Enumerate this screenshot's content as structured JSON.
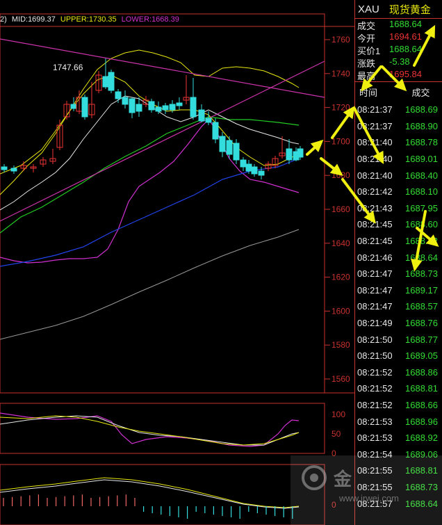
{
  "indicator_line": {
    "prefix": "2)",
    "mid": "MID:1699.37",
    "upper": "UPPER:1730.35",
    "lower": "LOWER:1668.39"
  },
  "high_label": "1747.66",
  "price_axis": [
    "1760",
    "1740",
    "1720",
    "1700",
    "1680",
    "1660",
    "1640",
    "1620",
    "1600",
    "1580",
    "1560"
  ],
  "kdj_axis": [
    "100",
    "50",
    "0"
  ],
  "sub2_axis": [
    "0"
  ],
  "quote": {
    "symbol": "XAU",
    "name": "现货黄金",
    "rows": [
      {
        "key": "成交",
        "value": "1688.64",
        "color": "green"
      },
      {
        "key": "今开",
        "value": "1694.61",
        "color": "red"
      },
      {
        "key": "买价1",
        "value": "1688.64",
        "color": "green"
      },
      {
        "key": "涨跌",
        "value": "-5.38",
        "color": "green"
      },
      {
        "key": "最高",
        "value": "1695.84",
        "color": "red"
      }
    ],
    "col_time": "时间",
    "col_price": "成交"
  },
  "ticks": [
    {
      "time": "08:21:37",
      "price": "1688.69"
    },
    {
      "time": "08:21:37",
      "price": "1688.90"
    },
    {
      "time": "08:21:40",
      "price": "1688.78"
    },
    {
      "time": "08:21:40",
      "price": "1689.01"
    },
    {
      "time": "08:21:40",
      "price": "1688.40"
    },
    {
      "time": "08:21:42",
      "price": "1688.10"
    },
    {
      "time": "08:21:43",
      "price": "1687.95"
    },
    {
      "time": "08:21:45",
      "price": "1688.60"
    },
    {
      "time": "08:21:45",
      "price": "1688.72"
    },
    {
      "time": "08:21:46",
      "price": "1688.64"
    },
    {
      "time": "08:21:47",
      "price": "1688.73"
    },
    {
      "time": "08:21:47",
      "price": "1689.17"
    },
    {
      "time": "08:21:47",
      "price": "1688.57"
    },
    {
      "time": "08:21:49",
      "price": "1688.76"
    },
    {
      "time": "08:21:50",
      "price": "1688.77"
    },
    {
      "time": "08:21:50",
      "price": "1689.05"
    },
    {
      "time": "08:21:52",
      "price": "1688.86"
    },
    {
      "time": "08:21:52",
      "price": "1688.81"
    },
    {
      "time": "08:21:52",
      "price": "1688.66"
    },
    {
      "time": "08:21:53",
      "price": "1688.96"
    },
    {
      "time": "08:21:53",
      "price": "1688.92"
    },
    {
      "time": "08:21:54",
      "price": "1689.06"
    },
    {
      "time": "08:21:55",
      "price": "1688.81"
    },
    {
      "time": "08:21:55",
      "price": "1688.73"
    },
    {
      "time": "08:21:57",
      "price": "1688.64"
    }
  ],
  "watermark": {
    "brand": "金",
    "site": "www.jrwei.com"
  },
  "colors": {
    "frame": "#c8322e",
    "up": "#ee3333",
    "down": "#33dddd",
    "mid": "#e8e8e8",
    "upper": "#e8e810",
    "lower": "#d030d0",
    "ma_green": "#22cc22",
    "ma_blue": "#2244ee",
    "ma_gray": "#999999",
    "channel": "#cc33aa",
    "arrow": "#f0f010"
  }
}
